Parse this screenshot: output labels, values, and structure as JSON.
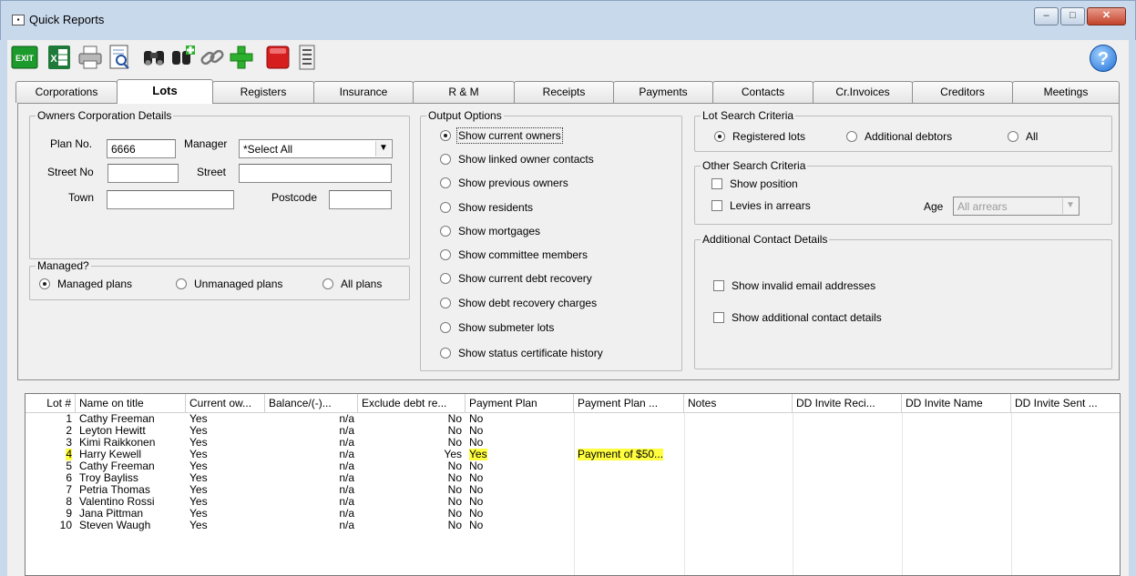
{
  "window": {
    "title": "Quick Reports",
    "minimize": "–",
    "maximize": "□",
    "close": "✕"
  },
  "toolbar": {
    "icons": [
      "exit-icon",
      "excel-icon",
      "print-icon",
      "print-preview-icon",
      "binoculars-icon",
      "find-add-icon",
      "link-icon",
      "add-icon",
      "stop-icon",
      "layout-icon"
    ],
    "exit_label": "EXIT",
    "excel_label": "X",
    "help_label": "?"
  },
  "tabs": [
    "Corporations",
    "Lots",
    "Registers",
    "Insurance",
    "R & M",
    "Receipts",
    "Payments",
    "Contacts",
    "Cr.Invoices",
    "Creditors",
    "Meetings"
  ],
  "active_tab": "Lots",
  "owners": {
    "legend": "Owners Corporation Details",
    "plan_label": "Plan No.",
    "plan_value": "6666",
    "manager_label": "Manager",
    "manager_value": "*Select All",
    "street_no_label": "Street No",
    "street_no_value": "",
    "street_label": "Street",
    "street_value": "",
    "town_label": "Town",
    "town_value": "",
    "postcode_label": "Postcode",
    "postcode_value": ""
  },
  "managed": {
    "legend": "Managed?",
    "options": [
      "Managed plans",
      "Unmanaged plans",
      "All plans"
    ],
    "selected": 0
  },
  "output": {
    "legend": "Output Options",
    "options": [
      "Show current owners",
      "Show linked owner contacts",
      "Show previous owners",
      "Show residents",
      "Show mortgages",
      "Show committee members",
      "Show current debt recovery",
      "Show debt recovery charges",
      "Show submeter lots",
      "Show status certificate history"
    ],
    "selected": 0
  },
  "lot_search": {
    "legend": "Lot Search Criteria",
    "options": [
      "Registered lots",
      "Additional debtors",
      "All"
    ],
    "selected": 0
  },
  "other_search": {
    "legend": "Other Search Criteria",
    "show_position": "Show position",
    "levies": "Levies in arrears",
    "age_label": "Age",
    "age_value": "All arrears"
  },
  "additional": {
    "legend": "Additional Contact Details",
    "invalid_email": "Show invalid email addresses",
    "additional_details": "Show additional contact details"
  },
  "grid": {
    "columns": [
      "Lot #",
      "Name on title",
      "Current ow...",
      "Balance/(-)...",
      "Exclude debt re...",
      "Payment Plan",
      "Payment Plan ...",
      "Notes",
      "DD Invite Reci...",
      "DD Invite Name",
      "DD Invite Sent ..."
    ],
    "rows": [
      {
        "lot": "1",
        "name": "Cathy Freeman",
        "current": "Yes",
        "balance": "n/a",
        "exclude": "No",
        "plan": "No",
        "plan_desc": "",
        "highlight": false
      },
      {
        "lot": "2",
        "name": "Leyton Hewitt",
        "current": "Yes",
        "balance": "n/a",
        "exclude": "No",
        "plan": "No",
        "plan_desc": "",
        "highlight": false
      },
      {
        "lot": "3",
        "name": "Kimi Raikkonen",
        "current": "Yes",
        "balance": "n/a",
        "exclude": "No",
        "plan": "No",
        "plan_desc": "",
        "highlight": false
      },
      {
        "lot": "4",
        "name": "Harry Kewell",
        "current": "Yes",
        "balance": "n/a",
        "exclude": "Yes",
        "plan": "Yes",
        "plan_desc": "Payment of $50...",
        "highlight": true
      },
      {
        "lot": "5",
        "name": "Cathy Freeman",
        "current": "Yes",
        "balance": "n/a",
        "exclude": "No",
        "plan": "No",
        "plan_desc": "",
        "highlight": false
      },
      {
        "lot": "6",
        "name": "Troy Bayliss",
        "current": "Yes",
        "balance": "n/a",
        "exclude": "No",
        "plan": "No",
        "plan_desc": "",
        "highlight": false
      },
      {
        "lot": "7",
        "name": "Petria Thomas",
        "current": "Yes",
        "balance": "n/a",
        "exclude": "No",
        "plan": "No",
        "plan_desc": "",
        "highlight": false
      },
      {
        "lot": "8",
        "name": "Valentino Rossi",
        "current": "Yes",
        "balance": "n/a",
        "exclude": "No",
        "plan": "No",
        "plan_desc": "",
        "highlight": false
      },
      {
        "lot": "9",
        "name": "Jana Pittman",
        "current": "Yes",
        "balance": "n/a",
        "exclude": "No",
        "plan": "No",
        "plan_desc": "",
        "highlight": false
      },
      {
        "lot": "10",
        "name": "Steven Waugh",
        "current": "Yes",
        "balance": "n/a",
        "exclude": "No",
        "plan": "No",
        "plan_desc": "",
        "highlight": false
      }
    ]
  },
  "colors": {
    "highlight": "#ffff40",
    "accent": "#1f6fd6"
  }
}
